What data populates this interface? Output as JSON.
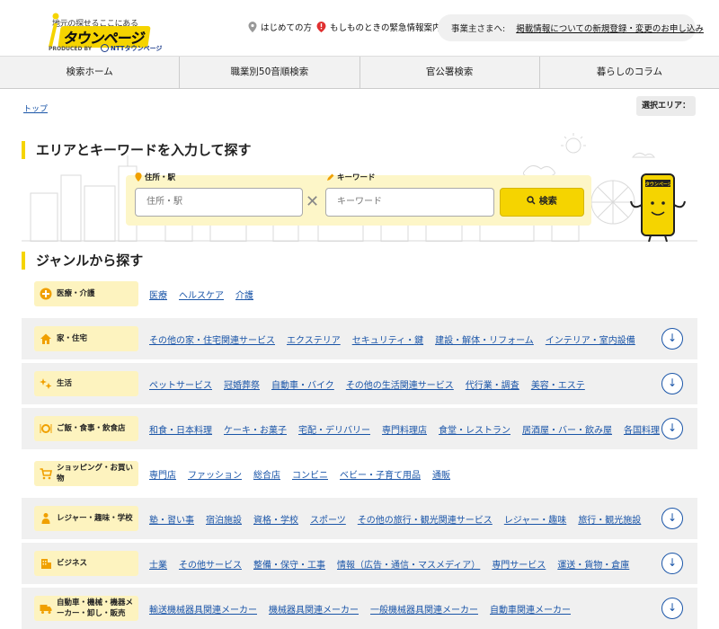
{
  "colors": {
    "accent": "#f5d400",
    "link": "#1a55a8",
    "warning": "#e03030",
    "category_bg": "#fdf3bf"
  },
  "header": {
    "logo_tagline": "地元の探せるここにある",
    "logo_name_prefix": "i",
    "logo_name": "タウンページ",
    "logo_produced_by": "PRODUCED BY",
    "logo_ntt": "NTTタウンページ",
    "beginner_link": "はじめての方",
    "emergency_link": "もしものときの緊急情報案内",
    "business_label": "事業主さまへ:",
    "business_link": "掲載情報についての新規登録・変更のお申し込み"
  },
  "nav": {
    "items": [
      "検索ホーム",
      "職業別50音順検索",
      "官公署検索",
      "暮らしのコラム"
    ]
  },
  "breadcrumb": {
    "top": "トップ"
  },
  "area_selector": {
    "label": "選択エリア："
  },
  "search": {
    "title": "エリアとキーワードを入力して探す",
    "area_label": "住所・駅",
    "area_placeholder": "住所・駅",
    "keyword_label": "キーワード",
    "keyword_placeholder": "キーワード",
    "button_label": "検索",
    "mascot_text": "iタウンページ"
  },
  "genre": {
    "title": "ジャンルから探す",
    "rows": [
      {
        "icon": "plus-icon",
        "category": "医療・介護",
        "links": [
          "医療",
          "ヘルスケア",
          "介護"
        ],
        "expandable": false
      },
      {
        "icon": "house-icon",
        "category": "家・住宅",
        "links": [
          "その他の家・住宅関連サービス",
          "エクステリア",
          "セキュリティ・鍵",
          "建設・解体・リフォーム",
          "インテリア・室内設備"
        ],
        "expandable": true
      },
      {
        "icon": "sparkle-icon",
        "category": "生活",
        "links": [
          "ペットサービス",
          "冠婚葬祭",
          "自動車・バイク",
          "その他の生活関連サービス",
          "代行業・調査",
          "美容・エステ"
        ],
        "expandable": true
      },
      {
        "icon": "dish-icon",
        "category": "ご飯・食事・飲食店",
        "links": [
          "和食・日本料理",
          "ケーキ・お菓子",
          "宅配・デリバリー",
          "専門料理店",
          "食堂・レストラン",
          "居酒屋・バー・飲み屋",
          "各国料理"
        ],
        "expandable": true
      },
      {
        "icon": "cart-icon",
        "category": "ショッピング・お買い物",
        "links": [
          "専門店",
          "ファッション",
          "総合店",
          "コンビニ",
          "ベビー・子育て用品",
          "通販"
        ],
        "expandable": false
      },
      {
        "icon": "person-icon",
        "category": "レジャー・趣味・学校",
        "links": [
          "塾・習い事",
          "宿泊施設",
          "資格・学校",
          "スポーツ",
          "その他の旅行・観光関連サービス",
          "レジャー・趣味",
          "旅行・観光施設"
        ],
        "expandable": true
      },
      {
        "icon": "building-icon",
        "category": "ビジネス",
        "links": [
          "士業",
          "その他サービス",
          "整備・保守・工事",
          "情報（広告・通信・マスメディア）",
          "専門サービス",
          "運送・貨物・倉庫"
        ],
        "expandable": true
      },
      {
        "icon": "truck-icon",
        "category": "自動車・機械・機器メーカー・卸し・販売",
        "links": [
          "輸送機械器具関連メーカー",
          "機械器具関連メーカー",
          "一般機械器具関連メーカー",
          "自動車関連メーカー"
        ],
        "expandable": true
      }
    ]
  }
}
